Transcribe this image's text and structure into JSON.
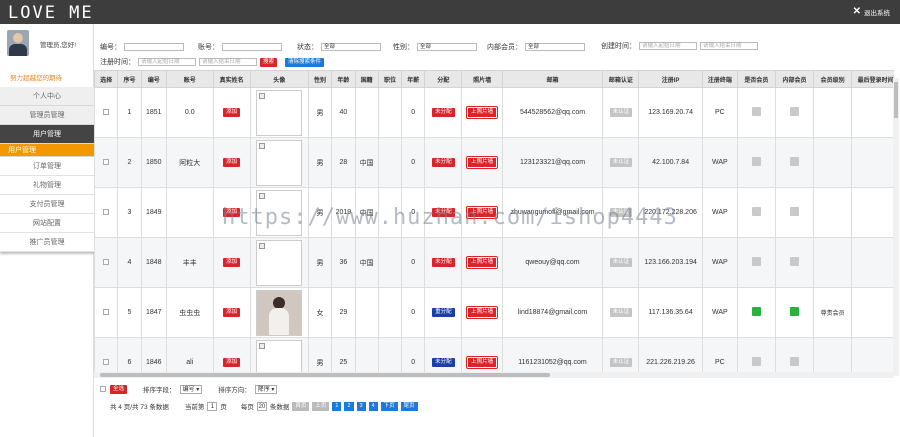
{
  "header": {
    "brand": "LOVE ME",
    "logout_label": "退出系统"
  },
  "sidebar": {
    "welcome": "管理员,您好!",
    "slogan": "努力超越您的期待",
    "items": [
      "个人中心",
      "管理员管理",
      "用户管理"
    ],
    "group_label": "用户管理",
    "subitems": [
      "订单管理",
      "礼物管理",
      "支付员管理",
      "网站配置",
      "推广员管理"
    ]
  },
  "filters": {
    "id_label": "编号：",
    "account_label": "账号：",
    "status_label": "状态：",
    "status_value": "全部",
    "gender_label": "性别：",
    "gender_value": "全部",
    "member_label": "内部会员：",
    "member_value": "全部",
    "created_label": "创建时间：",
    "created_start_ph": "请输入起始日期",
    "created_end_ph": "请输入结束日期",
    "reg_label": "注册时间：",
    "reg_start_ph": "请输入起始日期",
    "reg_end_ph": "请输入结束日期",
    "search_button": "搜索",
    "clear_button": "清除搜索条件"
  },
  "table": {
    "headers": [
      "选择",
      "序号",
      "编号",
      "账号",
      "真实姓名",
      "头像",
      "性别",
      "年龄",
      "国籍",
      "职位",
      "年薪",
      "分配",
      "照片墙",
      "邮箱",
      "邮箱认证",
      "注册IP",
      "注册终端",
      "是否会员",
      "内部会员",
      "会员级别",
      "最后登录时间"
    ],
    "rows": [
      {
        "seq": "1",
        "id": "1851",
        "account": "0.0",
        "realname": "添加",
        "gender": "男",
        "age": "40",
        "country": "",
        "job": "",
        "salary": "0",
        "assign": "未分配",
        "assign_color": "red",
        "wall": "上照片墙",
        "email": "544528562@qq.com",
        "verify": "未认证",
        "ip": "123.169.20.74",
        "terminal": "PC",
        "is_member": "gray",
        "internal": "gray",
        "level": "",
        "last": "",
        "photo": "broken"
      },
      {
        "seq": "2",
        "id": "1850",
        "account": "阿粒大",
        "realname": "添加",
        "gender": "男",
        "age": "28",
        "country": "中国",
        "job": "",
        "salary": "0",
        "assign": "未分配",
        "assign_color": "red",
        "wall": "上照片墙",
        "email": "123123321@qq.com",
        "verify": "未认证",
        "ip": "42.100.7.84",
        "terminal": "WAP",
        "is_member": "gray",
        "internal": "gray",
        "level": "",
        "last": "",
        "photo": "broken"
      },
      {
        "seq": "3",
        "id": "1849",
        "account": "",
        "realname": "添加",
        "gender": "男",
        "age": "2019",
        "country": "中国",
        "job": "",
        "salary": "0",
        "assign": "未分配",
        "assign_color": "red",
        "wall": "上照片墙",
        "email": "zhuwangumofl@gmail.com",
        "verify": "未认证",
        "ip": "220.172.228.206",
        "terminal": "WAP",
        "is_member": "gray",
        "internal": "gray",
        "level": "",
        "last": "",
        "photo": "broken"
      },
      {
        "seq": "4",
        "id": "1848",
        "account": "丰丰",
        "realname": "添加",
        "gender": "男",
        "age": "36",
        "country": "中国",
        "job": "",
        "salary": "0",
        "assign": "未分配",
        "assign_color": "red",
        "wall": "上照片墙",
        "email": "qweouy@qq.com",
        "verify": "未认证",
        "ip": "123.166.203.194",
        "terminal": "WAP",
        "is_member": "gray",
        "internal": "gray",
        "level": "",
        "last": "",
        "photo": "broken"
      },
      {
        "seq": "5",
        "id": "1847",
        "account": "虫虫虫",
        "realname": "添加",
        "gender": "女",
        "age": "29",
        "country": "",
        "job": "",
        "salary": "0",
        "assign": "重分配",
        "assign_color": "blue",
        "wall": "上照片墙",
        "email": "lind18874@gmail.com",
        "verify": "未认证",
        "ip": "117.136.35.64",
        "terminal": "WAP",
        "is_member": "green",
        "internal": "green",
        "level": "尊贵会员",
        "last": "2",
        "photo": "real"
      },
      {
        "seq": "6",
        "id": "1846",
        "account": "ali",
        "realname": "添加",
        "gender": "男",
        "age": "25",
        "country": "",
        "job": "",
        "salary": "0",
        "assign": "未分配",
        "assign_color": "blue",
        "wall": "上照片墙",
        "email": "1161231052@qq.com",
        "verify": "未认证",
        "ip": "221.226.219.26",
        "terminal": "PC",
        "is_member": "gray",
        "internal": "gray",
        "level": "",
        "last": "",
        "photo": "broken"
      }
    ]
  },
  "footer": {
    "select_all": "全选",
    "sort_field_label": "排序字段：",
    "sort_field_value": "编号",
    "sort_dir_label": "排序方向：",
    "sort_dir_value": "降序",
    "summary": "共 4 页/共 73 条数据",
    "current_label": "当前第",
    "current_page": "1",
    "page_unit": "页",
    "per_label": "每页",
    "per_value": "20",
    "per_unit": "条数据",
    "pager": {
      "first": "首页",
      "prev": "上页",
      "pages": [
        "1",
        "2",
        "3",
        "4"
      ],
      "next": "下页",
      "last": "尾页"
    }
  },
  "watermark": "https://www.huzhan.com/ishop4443",
  "colors": {
    "topbar": "#3d3d3d",
    "accent_orange": "#f39800",
    "red": "#d9242a",
    "blue": "#1d7ad8",
    "green": "#29b33e"
  }
}
